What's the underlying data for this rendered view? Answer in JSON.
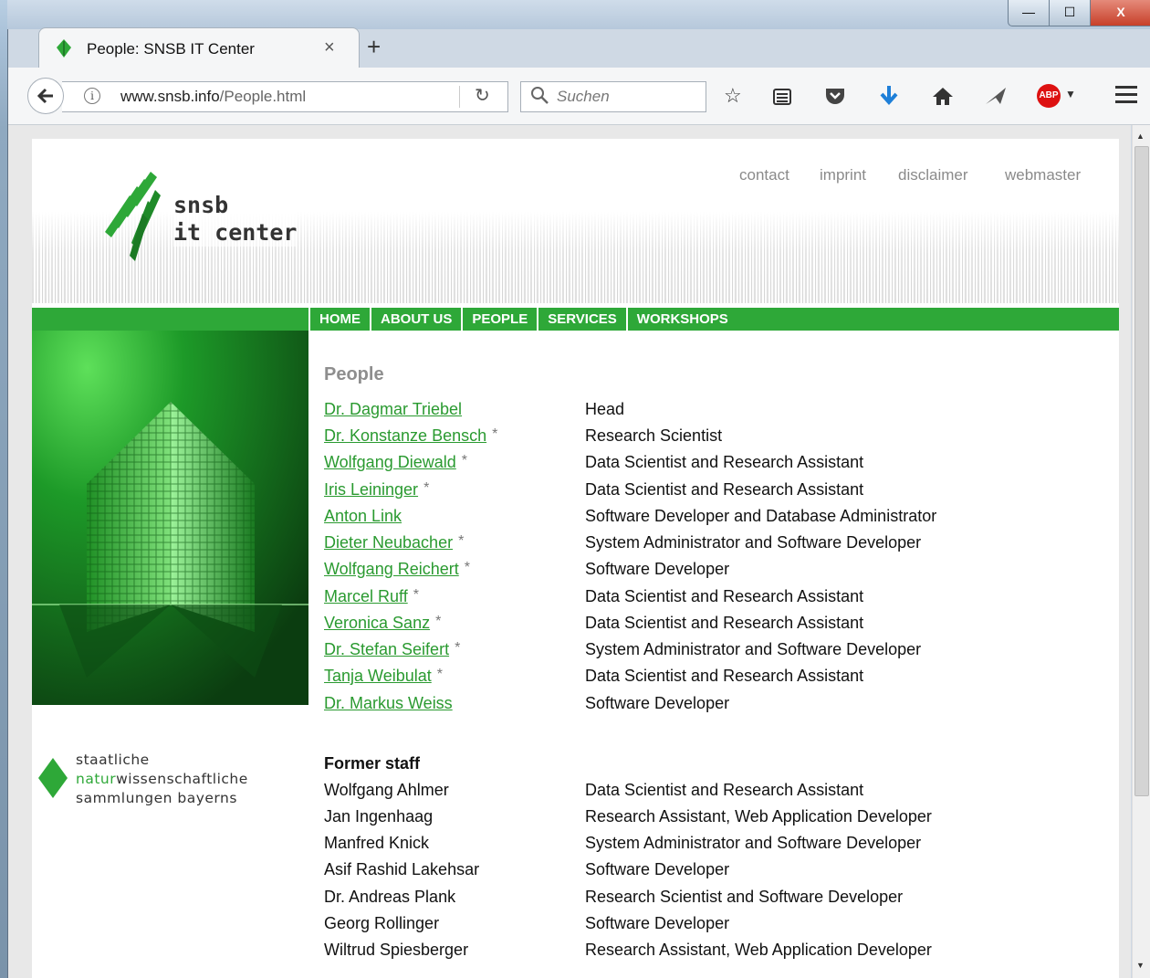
{
  "browser": {
    "tab_title": "People: SNSB IT Center",
    "tab_close": "×",
    "new_tab": "+",
    "url_host": "www.snsb.info",
    "url_path": "/People.html",
    "search_placeholder": "Suchen",
    "win_close": "X",
    "win_min": "—",
    "win_max": "☐",
    "abp_label": "ABP"
  },
  "site": {
    "logo_line1": "snsb",
    "logo_line2": "it center",
    "top_links": [
      "contact",
      "imprint",
      "disclaimer",
      "webmaster"
    ],
    "menu": [
      "HOME",
      "ABOUT US",
      "PEOPLE",
      "SERVICES",
      "WORKSHOPS"
    ],
    "snsb_line1": "staatliche",
    "snsb_line2_green": "natur",
    "snsb_line2_rest": "wissenschaftliche",
    "snsb_line3": "sammlungen bayerns"
  },
  "people": {
    "heading": "People",
    "star": "*",
    "staff": [
      {
        "name": "Dr. Dagmar Triebel",
        "star": false,
        "role": "Head"
      },
      {
        "name": "Dr. Konstanze Bensch",
        "star": true,
        "role": "Research Scientist"
      },
      {
        "name": "Wolfgang Diewald",
        "star": true,
        "role": "Data Scientist and Research Assistant"
      },
      {
        "name": "Iris Leininger",
        "star": true,
        "role": "Data Scientist and Research Assistant"
      },
      {
        "name": "Anton Link",
        "star": false,
        "role": "Software Developer and Database Administrator"
      },
      {
        "name": "Dieter Neubacher",
        "star": true,
        "role": "System Administrator and Software Developer"
      },
      {
        "name": "Wolfgang Reichert",
        "star": true,
        "role": "Software Developer"
      },
      {
        "name": "Marcel Ruff",
        "star": true,
        "role": "Data Scientist and Research Assistant"
      },
      {
        "name": "Veronica Sanz",
        "star": true,
        "role": "Data Scientist and Research Assistant"
      },
      {
        "name": "Dr. Stefan Seifert",
        "star": true,
        "role": "System Administrator and Software Developer"
      },
      {
        "name": "Tanja Weibulat",
        "star": true,
        "role": "Data Scientist and Research Assistant"
      },
      {
        "name": "Dr. Markus Weiss",
        "star": false,
        "role": "Software Developer"
      }
    ],
    "former_heading": "Former staff",
    "former": [
      {
        "name": "Wolfgang Ahlmer",
        "role": "Data Scientist and Research Assistant"
      },
      {
        "name": "Jan Ingenhaag",
        "role": "Research Assistant, Web Application Developer"
      },
      {
        "name": "Manfred Knick",
        "role": "System Administrator and Software Developer"
      },
      {
        "name": "Asif Rashid Lakehsar",
        "role": "Software Developer"
      },
      {
        "name": "Dr. Andreas Plank",
        "role": "Research Scientist and Software Developer"
      },
      {
        "name": "Georg Rollinger",
        "role": "Software Developer"
      },
      {
        "name": "Wiltrud Spiesberger",
        "role": "Research Assistant, Web Application Developer"
      }
    ]
  },
  "colors": {
    "accent_green": "#2ea838",
    "link_green": "#2a9a30"
  }
}
